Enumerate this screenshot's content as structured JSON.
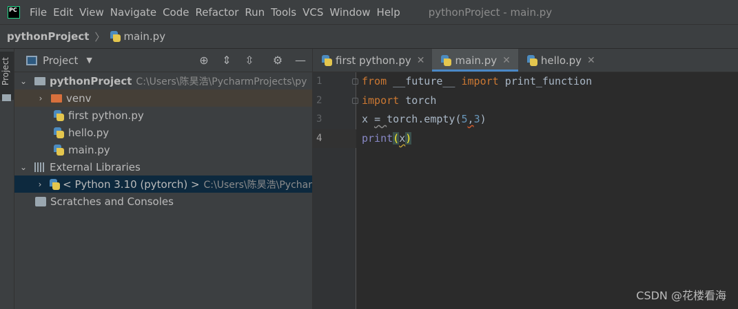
{
  "menubar": {
    "logo_text": "PC",
    "items": [
      {
        "label": "File"
      },
      {
        "label": "Edit"
      },
      {
        "label": "View"
      },
      {
        "label": "Navigate"
      },
      {
        "label": "Code"
      },
      {
        "label": "Refactor"
      },
      {
        "label": "Run"
      },
      {
        "label": "Tools"
      },
      {
        "label": "VCS"
      },
      {
        "label": "Window"
      },
      {
        "label": "Help"
      }
    ],
    "window_title": "pythonProject - main.py"
  },
  "navbar": {
    "project": "pythonProject",
    "separator": "〉",
    "file": "main.py"
  },
  "left_strip": {
    "label": "Project"
  },
  "project_panel": {
    "title": "Project",
    "tree": [
      {
        "label": "pythonProject",
        "path": "C:\\Users\\陈昊浩\\PycharmProjects\\py"
      },
      {
        "label": "venv"
      },
      {
        "label": "first python.py"
      },
      {
        "label": "hello.py"
      },
      {
        "label": "main.py"
      },
      {
        "label": "External Libraries"
      },
      {
        "label": "< Python 3.10 (pytorch) >",
        "path": "C:\\Users\\陈昊浩\\Pychar"
      },
      {
        "label": "Scratches and Consoles"
      }
    ]
  },
  "editor": {
    "tabs": [
      {
        "label": "first python.py",
        "close": "✕"
      },
      {
        "label": "main.py",
        "close": "✕"
      },
      {
        "label": "hello.py",
        "close": "✕"
      }
    ],
    "line_numbers": [
      "1",
      "2",
      "3",
      "4"
    ],
    "code": {
      "l1_kw1": "from",
      "l1_mod": "__future__",
      "l1_kw2": "import",
      "l1_name": "print_function",
      "l2_kw": "import",
      "l2_mod": "torch",
      "l3_a": "x ",
      "l3_eq": "=",
      "l3_sp": " ",
      "l3_b": "torch.empty(",
      "l3_n1": "5",
      "l3_comma": ",",
      "l3_n2": "3",
      "l3_close": ")",
      "l4_fn": "print",
      "l4_open": "(",
      "l4_arg": "x",
      "l4_close": ")"
    }
  },
  "watermark": "CSDN @花楼看海",
  "colors": {
    "accent": "#4a88c7",
    "keyword": "#cc7832",
    "number": "#6897bb",
    "builtin": "#8888c6"
  }
}
